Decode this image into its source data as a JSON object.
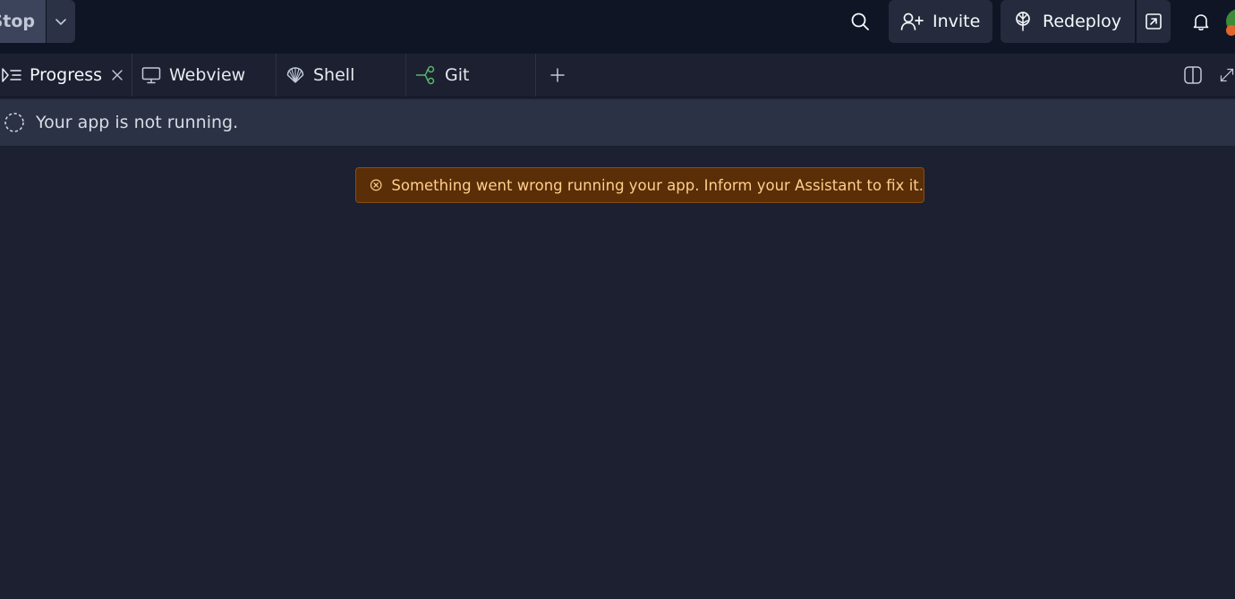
{
  "header": {
    "stop_label": "Stop",
    "invite_label": "Invite",
    "redeploy_label": "Redeploy"
  },
  "tabs": [
    {
      "label": "Progress",
      "icon": "progress-icon",
      "active": true
    },
    {
      "label": "Webview",
      "icon": "monitor-icon"
    },
    {
      "label": "Shell",
      "icon": "shell-icon"
    },
    {
      "label": "Git",
      "icon": "git-icon"
    }
  ],
  "status": {
    "message": "Your app is not running."
  },
  "error": {
    "message": "Something went wrong running your app. Inform your Assistant to fix it."
  },
  "colors": {
    "background": "#1c2031",
    "header_bg": "#0f1524",
    "status_bg": "#2b3245",
    "error_bg": "#5a2e07",
    "error_text": "#ffcf8c",
    "git_icon": "#58b86a"
  }
}
